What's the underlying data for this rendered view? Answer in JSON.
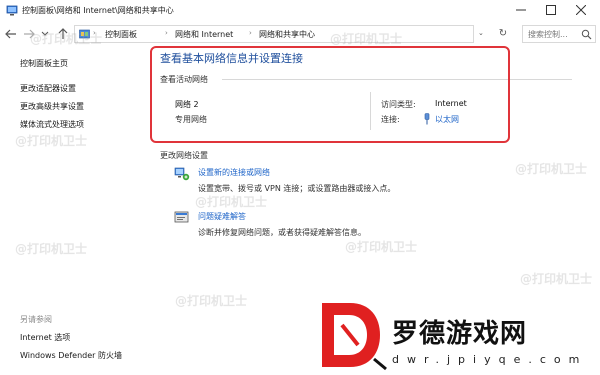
{
  "window": {
    "title": "控制面板\\网络和 Internet\\网络和共享中心"
  },
  "addressbar": {
    "crumbs": [
      "控制面板",
      "网络和 Internet",
      "网络和共享中心"
    ],
    "search_placeholder": "搜索控制..."
  },
  "leftpane": {
    "links": [
      "控制面板主页",
      "更改适配器设置",
      "更改高级共享设置",
      "媒体流式处理选项"
    ],
    "see_also_label": "另请参阅",
    "see_also_links": [
      "Internet 选项",
      "Windows Defender 防火墙"
    ]
  },
  "main": {
    "title": "查看基本网络信息并设置连接",
    "active_networks_label": "查看活动网络",
    "network": {
      "name": "网络 2",
      "type": "专用网络",
      "access_type_label": "访问类型:",
      "access_type_value": "Internet",
      "connections_label": "连接:",
      "connections_value": "以太网"
    },
    "change_settings_label": "更改网络设置",
    "tasks": [
      {
        "link": "设置新的连接或网络",
        "desc": "设置宽带、拨号或 VPN 连接；或设置路由器或接入点。",
        "icon": "network-setup-icon"
      },
      {
        "link": "问题疑难解答",
        "desc": "诊断并修复网络问题，或者获得疑难解答信息。",
        "icon": "troubleshoot-icon"
      }
    ]
  },
  "watermark": "@打印机卫士",
  "logo": {
    "big": "罗德游戏网",
    "sub": "dwr.jpiyqe.com"
  },
  "colors": {
    "link": "#1e64c8",
    "title": "#1e4e9c",
    "highlight": "#e0343a"
  }
}
